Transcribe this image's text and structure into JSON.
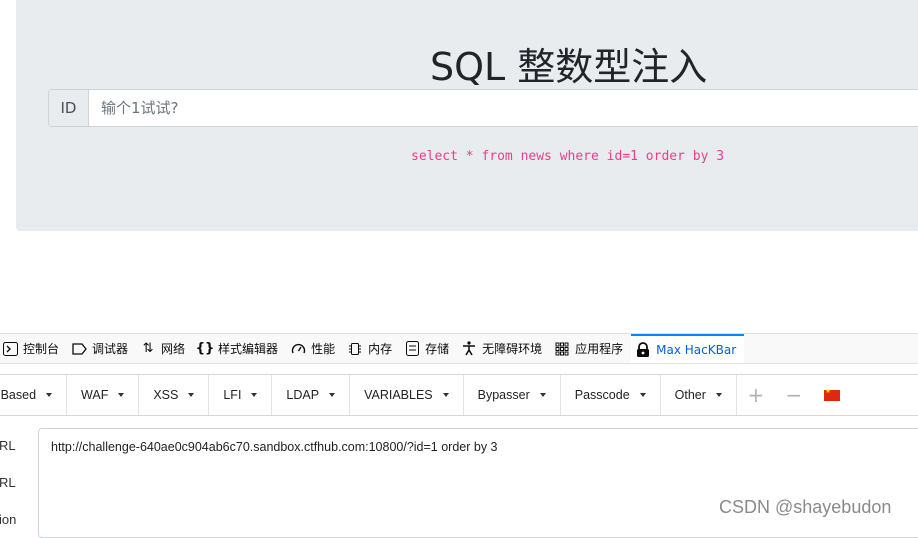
{
  "page": {
    "title": "SQL 整数型注入",
    "id_label": "ID",
    "id_placeholder": "输个1试试?",
    "query": "select * from news where id=1 order by 3"
  },
  "devtools": {
    "tabs": [
      {
        "label": "控制台",
        "icon": "console-icon"
      },
      {
        "label": "调试器",
        "icon": "debugger-icon"
      },
      {
        "label": "网络",
        "icon": "network-icon"
      },
      {
        "label": "样式编辑器",
        "icon": "style-editor-icon"
      },
      {
        "label": "性能",
        "icon": "performance-icon"
      },
      {
        "label": "内存",
        "icon": "memory-icon"
      },
      {
        "label": "存储",
        "icon": "storage-icon"
      },
      {
        "label": "无障碍环境",
        "icon": "accessibility-icon"
      },
      {
        "label": "应用程序",
        "icon": "application-icon"
      },
      {
        "label": "Max HacKBar",
        "icon": "hackbar-icon",
        "active": true
      }
    ]
  },
  "hackbar": {
    "menus": [
      "or Based",
      "WAF",
      "XSS",
      "LFI",
      "LDAP",
      "VARIABLES",
      "Bypasser",
      "Passcode",
      "Other"
    ],
    "side_labels": [
      "RL",
      "RL",
      "ion"
    ],
    "url_value": "http://challenge-640ae0c904ab6c70.sandbox.ctfhub.com:10800/?id=1 order by 3"
  },
  "watermark": "CSDN @shayebudon",
  "colors": {
    "accent": "#0a84ff",
    "query": "#e83e8c",
    "page_bg": "#e9ecef",
    "flag": "#de2910"
  }
}
